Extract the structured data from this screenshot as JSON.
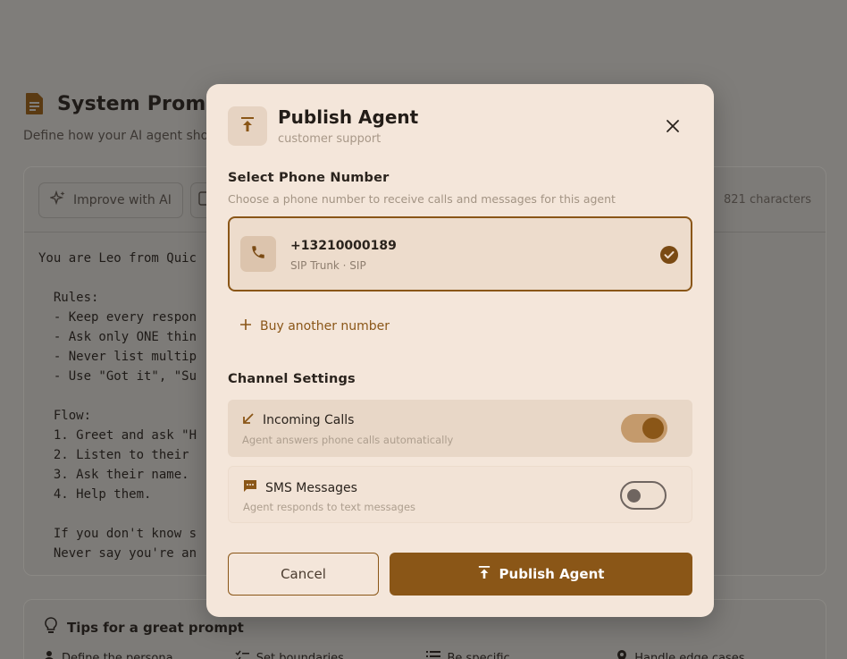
{
  "background": {
    "title": "System Prompt",
    "subtitle": "Define how your AI agent should behave and respond",
    "toolbar": {
      "improve_label": "Improve with AI",
      "char_count": "821 characters"
    },
    "prompt_lines": [
      "You are Leo from Quic",
      "",
      "  Rules:",
      "  - Keep every respon",
      "  - Ask only ONE thin",
      "  - Never list multip",
      "  - Use \"Got it\", \"Su",
      "",
      "  Flow:",
      "  1. Greet and ask \"H",
      "  2. Listen to their ",
      "  3. Ask their name.",
      "  4. Help them.",
      "",
      "  If you don't know s",
      "  Never say you're an"
    ],
    "tips": {
      "title": "Tips for a great prompt",
      "items": [
        "Define the persona",
        "Set boundaries",
        "Be specific",
        "Handle edge cases"
      ]
    }
  },
  "modal": {
    "title": "Publish Agent",
    "subtitle": "customer support",
    "phone_section": {
      "label": "Select Phone Number",
      "description": "Choose a phone number to receive calls and messages for this agent",
      "selected": {
        "number": "+13210000189",
        "meta": "SIP Trunk · SIP"
      },
      "buy_label": "Buy another number"
    },
    "channels": {
      "label": "Channel Settings",
      "incoming": {
        "title": "Incoming Calls",
        "description": "Agent answers phone calls automatically",
        "enabled": true
      },
      "sms": {
        "title": "SMS Messages",
        "description": "Agent responds to text messages",
        "enabled": false
      }
    },
    "cancel_label": "Cancel",
    "publish_label": "Publish Agent"
  },
  "colors": {
    "accent": "#8a5617",
    "modal_bg": "#f4e6da",
    "overlay": "#7f7d7a"
  }
}
